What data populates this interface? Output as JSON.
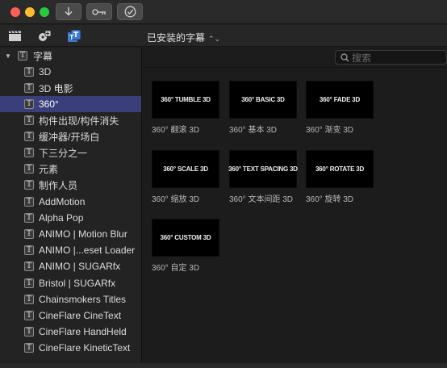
{
  "toolbar": {
    "library_title": "已安装的字幕",
    "library_chevron": "⌃⌄"
  },
  "search": {
    "placeholder": "搜索"
  },
  "sidebar": {
    "root": {
      "label": "字幕"
    },
    "items": [
      {
        "label": "3D"
      },
      {
        "label": "3D 电影"
      },
      {
        "label": "360°",
        "selected": true
      },
      {
        "label": "构件出现/构件消失"
      },
      {
        "label": "缓冲器/开场白"
      },
      {
        "label": "下三分之一"
      },
      {
        "label": "元素"
      },
      {
        "label": "制作人员"
      },
      {
        "label": "AddMotion"
      },
      {
        "label": "Alpha Pop"
      },
      {
        "label": "ANIMO | Motion Blur"
      },
      {
        "label": "ANIMO |...eset Loader"
      },
      {
        "label": "ANIMO | SUGARfx"
      },
      {
        "label": "Bristol | SUGARfx"
      },
      {
        "label": "Chainsmokers Titles"
      },
      {
        "label": "CineFlare CineText"
      },
      {
        "label": "CineFlare HandHeld"
      },
      {
        "label": "CineFlare KineticText"
      }
    ]
  },
  "tiles": [
    {
      "thumb": "360° TUMBLE 3D",
      "caption": "360° 翻滚 3D"
    },
    {
      "thumb": "360° BASIC 3D",
      "caption": "360° 基本 3D"
    },
    {
      "thumb": "360° FADE 3D",
      "caption": "360° 渐变 3D"
    },
    {
      "thumb": "360° SCALE 3D",
      "caption": "360° 缩放 3D"
    },
    {
      "thumb": "360° TEXT SPACING 3D",
      "caption": "360° 文本间距 3D"
    },
    {
      "thumb": "360° ROTATE 3D",
      "caption": "360° 旋转 3D"
    },
    {
      "thumb": "360° CUSTOM 3D",
      "caption": "360° 自定 3D"
    }
  ],
  "colors": {
    "selection": "#3a3f7c",
    "accent_blue": "#3d7bd9"
  }
}
